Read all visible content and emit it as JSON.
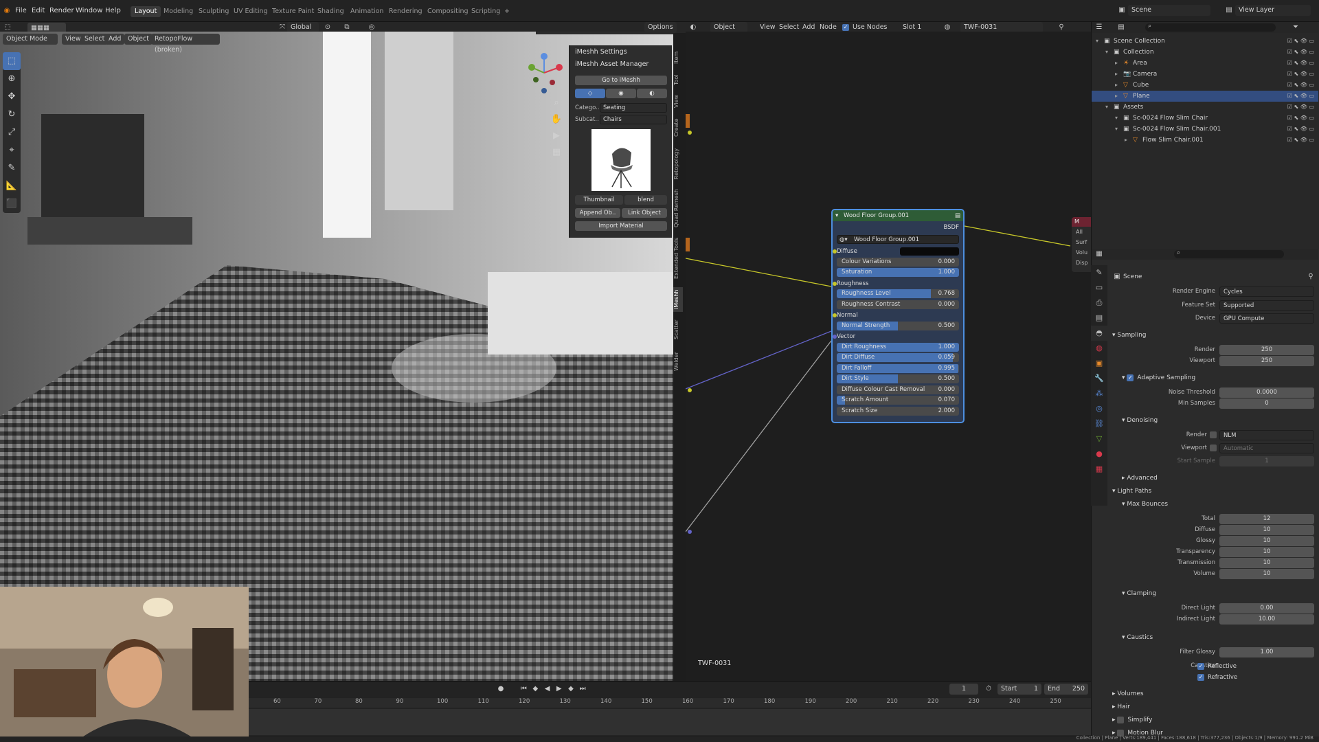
{
  "topbar": {
    "menus": [
      "File",
      "Edit",
      "Render",
      "Window",
      "Help"
    ],
    "workspaces": [
      "Layout",
      "Modeling",
      "Sculpting",
      "UV Editing",
      "Texture Paint",
      "Shading",
      "Animation",
      "Rendering",
      "Compositing",
      "Scripting"
    ],
    "active_workspace": "Layout",
    "add_tab": "+",
    "scene": "Scene",
    "view_layer": "View Layer"
  },
  "viewport_header": {
    "mode": "Object Mode",
    "menus": [
      "View",
      "Select",
      "Add",
      "Object"
    ],
    "addon": "RetopoFlow (broken)",
    "transform": "Global",
    "options": "Options"
  },
  "npanel": {
    "settings_title": "iMeshh Settings",
    "asset_manager_title": "iMeshh Asset Manager",
    "go_button": "Go to iMeshh",
    "category_label": "Catego..",
    "category_value": "Seating",
    "subcategory_label": "Subcat..",
    "subcategory_value": "Chairs",
    "thumbnail_btn": "Thumbnail",
    "blend_btn": "blend",
    "append_btn": "Append Ob..",
    "link_btn": "Link Object",
    "import_btn": "Import Material",
    "tabs": [
      "Item",
      "Tool",
      "View",
      "Create",
      "Retopology",
      "Quad Remesh",
      "Extended Tools",
      "iMeshh",
      "Scatter",
      "Welder"
    ]
  },
  "node_header": {
    "object": "Object",
    "menus": [
      "View",
      "Select",
      "Add",
      "Node"
    ],
    "use_nodes": "Use Nodes",
    "slot": "Slot 1",
    "material": "TWF-0031"
  },
  "node": {
    "title": "Wood Floor Group.001",
    "bsdf": "BSDF",
    "group_name": "Wood Floor Group.001",
    "rows": [
      {
        "kind": "socket",
        "label": "Diffuse"
      },
      {
        "kind": "field",
        "label": "Colour Variations",
        "value": "0.000",
        "fill": 0.0
      },
      {
        "kind": "field",
        "label": "Saturation",
        "value": "1.000",
        "fill": 1.0
      },
      {
        "kind": "socket",
        "label": "Roughness"
      },
      {
        "kind": "field",
        "label": "Roughness Level",
        "value": "0.768",
        "fill": 0.768
      },
      {
        "kind": "field",
        "label": "Roughness Contrast",
        "value": "0.000",
        "fill": 0.0
      },
      {
        "kind": "socket",
        "label": "Normal"
      },
      {
        "kind": "field",
        "label": "Normal Strength",
        "value": "0.500",
        "fill": 0.5
      },
      {
        "kind": "socket",
        "label": "Vector"
      },
      {
        "kind": "field",
        "label": "Dirt Roughness",
        "value": "1.000",
        "fill": 1.0
      },
      {
        "kind": "field",
        "label": "Dirt Diffuse",
        "value": "0.059",
        "fill": 0.95
      },
      {
        "kind": "field",
        "label": "Dirt Falloff",
        "value": "0.995",
        "fill": 0.995
      },
      {
        "kind": "field",
        "label": "Dirt Style",
        "value": "0.500",
        "fill": 0.5
      },
      {
        "kind": "field",
        "label": "Diffuse Colour Cast Removal",
        "value": "0.000",
        "fill": 0.0
      },
      {
        "kind": "field",
        "label": "Scratch Amount",
        "value": "0.070",
        "fill": 0.07
      },
      {
        "kind": "field",
        "label": "Scratch Size",
        "value": "2.000",
        "fill": 0.0
      }
    ],
    "material_label": "TWF-0031",
    "output_labels": [
      "M",
      "All",
      "Surf",
      "Volu",
      "Disp"
    ]
  },
  "outliner": {
    "rows": [
      {
        "label": "Scene Collection",
        "indent": 0,
        "sel": false
      },
      {
        "label": "Collection",
        "indent": 1,
        "sel": false
      },
      {
        "label": "Area",
        "indent": 2,
        "sel": false
      },
      {
        "label": "Camera",
        "indent": 2,
        "sel": false
      },
      {
        "label": "Cube",
        "indent": 2,
        "sel": false
      },
      {
        "label": "Plane",
        "indent": 2,
        "sel": true
      },
      {
        "label": "Assets",
        "indent": 1,
        "sel": false
      },
      {
        "label": "Sc-0024 Flow Slim Chair",
        "indent": 2,
        "sel": false
      },
      {
        "label": "Sc-0024 Flow Slim Chair.001",
        "indent": 2,
        "sel": false
      },
      {
        "label": "Flow Slim Chair.001",
        "indent": 3,
        "sel": false
      }
    ]
  },
  "props": {
    "scene": "Scene",
    "render_engine_label": "Render Engine",
    "render_engine": "Cycles",
    "feature_set_label": "Feature Set",
    "feature_set": "Supported",
    "device_label": "Device",
    "device": "GPU Compute",
    "sampling": "Sampling",
    "render_label": "Render",
    "render_samples": "250",
    "viewport_label": "Viewport",
    "viewport_samples": "250",
    "adaptive": "Adaptive Sampling",
    "noise_label": "Noise Threshold",
    "noise": "0.0000",
    "min_label": "Min Samples",
    "min": "0",
    "denoising": "Denoising",
    "den_render_label": "Render",
    "den_render": "NLM",
    "den_viewport_label": "Viewport",
    "den_viewport": "Automatic",
    "start_sample_label": "Start Sample",
    "start_sample": "1",
    "advanced": "Advanced",
    "light_paths": "Light Paths",
    "max_bounces": "Max Bounces",
    "bounces": [
      {
        "label": "Total",
        "value": "12"
      },
      {
        "label": "Diffuse",
        "value": "10"
      },
      {
        "label": "Glossy",
        "value": "10"
      },
      {
        "label": "Transparency",
        "value": "10"
      },
      {
        "label": "Transmission",
        "value": "10"
      },
      {
        "label": "Volume",
        "value": "10"
      }
    ],
    "clamping": "Clamping",
    "direct_label": "Direct Light",
    "direct": "0.00",
    "indirect_label": "Indirect Light",
    "indirect": "10.00",
    "caustics": "Caustics",
    "filter_label": "Filter Glossy",
    "filter": "1.00",
    "caustics_label": "Caustics",
    "reflective": "Reflective",
    "refractive": "Refractive",
    "volumes": "Volumes",
    "hair": "Hair",
    "simplify": "Simplify",
    "motion_blur": "Motion Blur"
  },
  "timeline": {
    "frame": "1",
    "start_label": "Start",
    "start": "1",
    "end_label": "End",
    "end": "250",
    "ticks": [
      "60",
      "70",
      "80",
      "90",
      "100",
      "110",
      "120",
      "130",
      "140",
      "150",
      "160",
      "170",
      "180",
      "190",
      "200",
      "210",
      "220",
      "230",
      "240",
      "250"
    ]
  },
  "status": "Collection | Plane | Verts:189,441 | Faces:188,618 | Tris:377,236 | Objects:1/9 | Memory: 991.2 MiB"
}
